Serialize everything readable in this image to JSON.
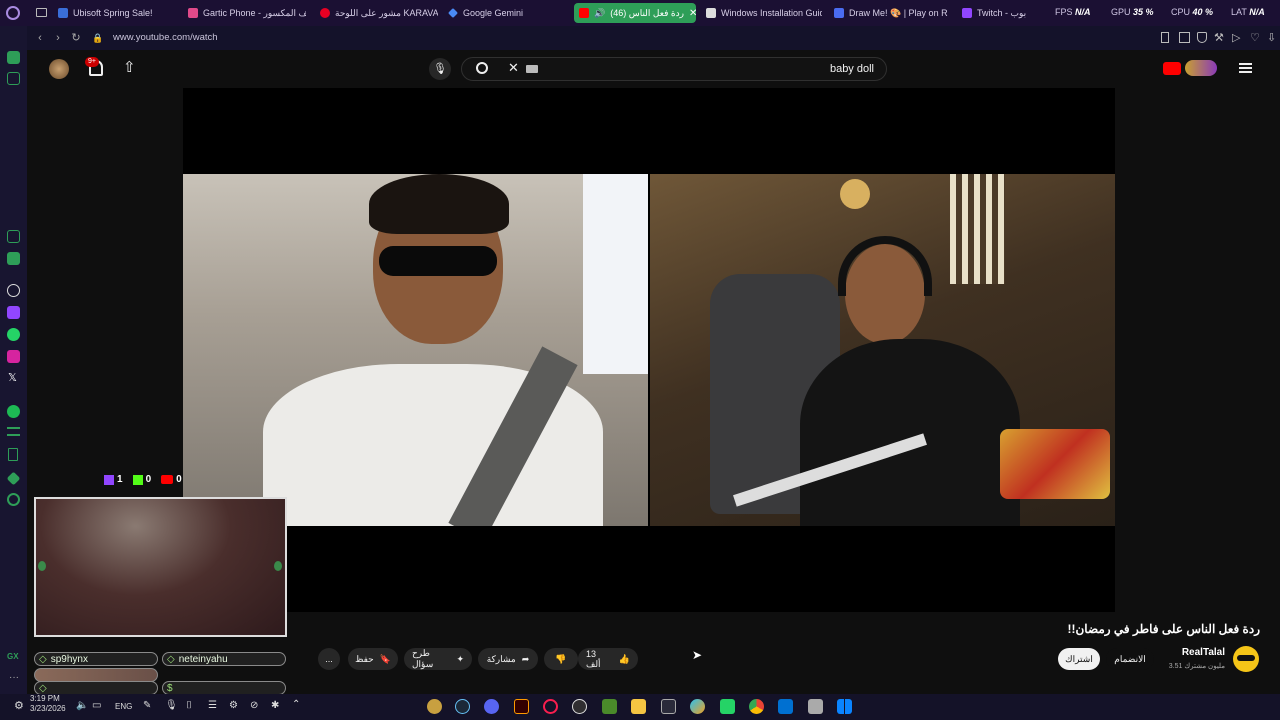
{
  "tabs": [
    {
      "label": "Ubisoft Spring Sale!",
      "color": "#3a6ed8"
    },
    {
      "label": "Gartic Phone - الهاتف المكسور",
      "color": "#e04a8a"
    },
    {
      "label": "مشور على اللوحة KARAVANA",
      "color": "#e60023"
    },
    {
      "label": "Google Gemini",
      "color": "#4a8af4"
    },
    {
      "label": "ردة فعل الناس (46)",
      "color": "#ff0000",
      "active": true
    },
    {
      "label": "Windows Installation Guide",
      "color": "#dddddd"
    },
    {
      "label": "Draw Me! 🎨 | Play on Roblox",
      "color": "#4a6cf0"
    },
    {
      "label": "Twitch - بوب",
      "color": "#9146ff"
    }
  ],
  "stats": {
    "fps_label": "FPS",
    "fps_value": "N/A",
    "gpu_label": "GPU",
    "gpu_value": "35 %",
    "cpu_label": "CPU",
    "cpu_value": "40 %",
    "lat_label": "LAT",
    "lat_value": "N/A"
  },
  "address": {
    "url": "www.youtube.com/watch"
  },
  "youtube": {
    "notif_count": "9+",
    "search_query": "baby doll",
    "video_title": "ردة فعل الناس على فاطر في رمضان!!",
    "channel_name": "RealTalal",
    "subscribers": "3.51 مليون مشترك",
    "subscribe_label": "اشتراك",
    "join_label": "الانضمام",
    "likes": "13 ألف",
    "share_label": "مشاركة",
    "ask_label": "طرح سؤال",
    "save_label": "حفظ",
    "more_label": "..."
  },
  "overlay": {
    "twitch_count": "1",
    "kick_count": "0",
    "youtube_count": "0",
    "chatters": [
      "sp9hynx",
      "neteinyahu"
    ]
  },
  "taskbar": {
    "time": "3:19 PM",
    "date": "3/23/2026",
    "lang": "ENG"
  }
}
